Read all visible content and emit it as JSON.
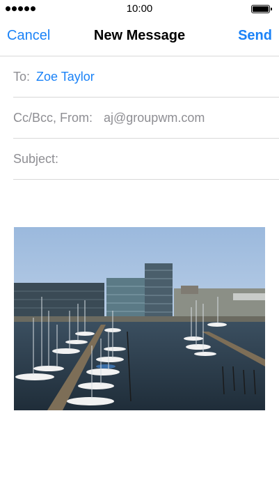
{
  "status_bar": {
    "time": "10:00",
    "signal_dots": 5,
    "battery_level": 1.0
  },
  "nav": {
    "cancel_label": "Cancel",
    "title": "New Message",
    "send_label": "Send",
    "accent_color": "#1a82f7"
  },
  "fields": {
    "to_label": "To:",
    "to_value": "Zoe Taylor",
    "ccbcc_label": "Cc/Bcc, From:",
    "from_value": "aj@groupwm.com",
    "subject_label": "Subject:",
    "subject_value": ""
  },
  "attachment": {
    "icon": "photo-icon"
  }
}
